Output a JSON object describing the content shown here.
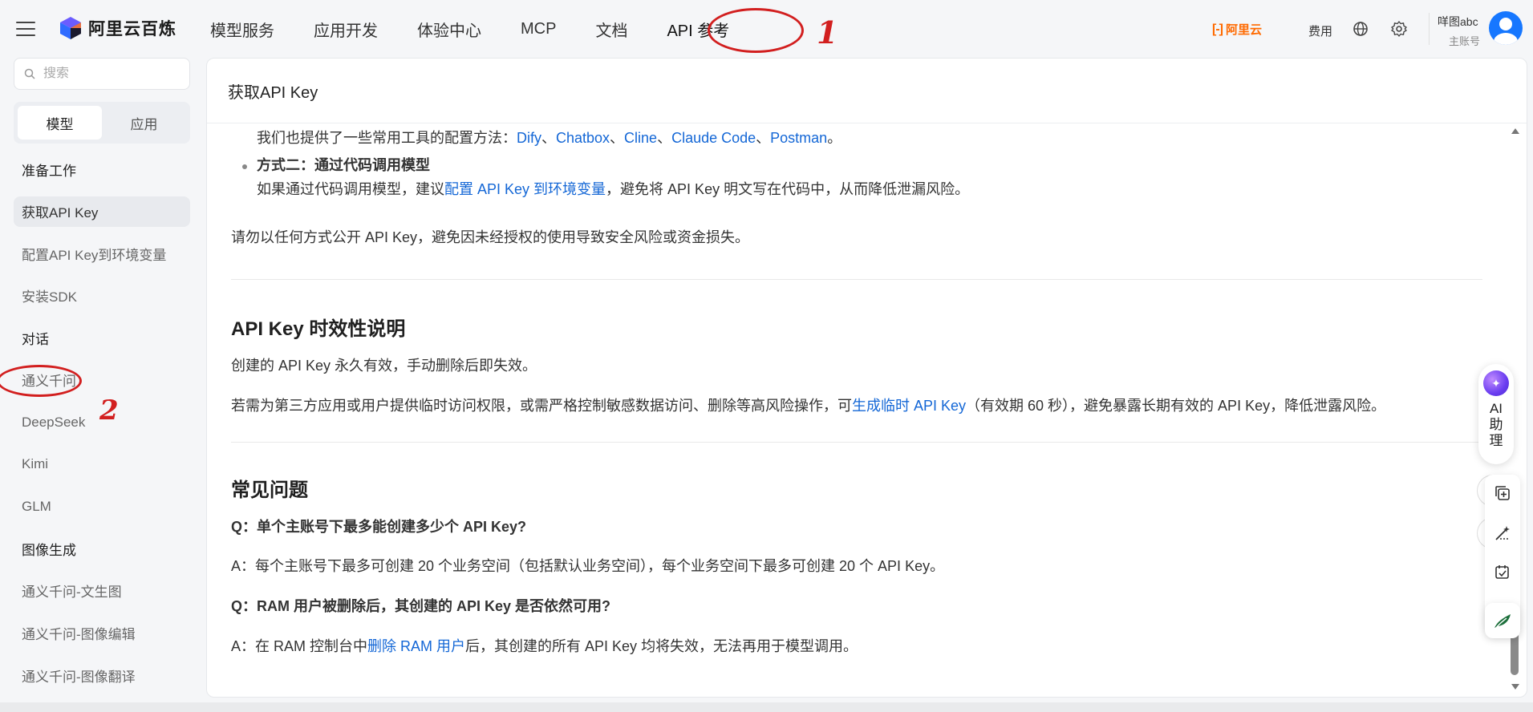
{
  "brand": {
    "name": "阿里云百炼"
  },
  "topnav": {
    "items": [
      {
        "label": "模型服务"
      },
      {
        "label": "应用开发"
      },
      {
        "label": "体验中心"
      },
      {
        "label": "MCP"
      },
      {
        "label": "文档"
      },
      {
        "label": "API 参考",
        "active": true
      }
    ]
  },
  "topright": {
    "aliyun_label": "阿里云",
    "fee_label": "费用",
    "user_name": "咩图abc",
    "user_role": "主账号"
  },
  "annotations": {
    "nav_mark": "1",
    "sidebar_mark": "2"
  },
  "sidebar": {
    "search_placeholder": "搜索",
    "segments": [
      "模型",
      "应用"
    ],
    "items": [
      {
        "label": "准备工作",
        "type": "group"
      },
      {
        "label": "获取API Key",
        "type": "item",
        "active": true
      },
      {
        "label": "配置API Key到环境变量",
        "type": "item"
      },
      {
        "label": "安装SDK",
        "type": "item"
      },
      {
        "label": "对话",
        "type": "group"
      },
      {
        "label": "通义千问",
        "type": "item"
      },
      {
        "label": "DeepSeek",
        "type": "item"
      },
      {
        "label": "Kimi",
        "type": "item"
      },
      {
        "label": "GLM",
        "type": "item"
      },
      {
        "label": "图像生成",
        "type": "group"
      },
      {
        "label": "通义千问-文生图",
        "type": "item"
      },
      {
        "label": "通义千问-图像编辑",
        "type": "item"
      },
      {
        "label": "通义千问-图像翻译",
        "type": "item"
      }
    ]
  },
  "page": {
    "title": "获取API Key",
    "tools_intro": "我们也提供了一些常用工具的配置方法：",
    "tools_links": [
      "Dify",
      "Chatbox",
      "Cline",
      "Claude Code",
      "Postman"
    ],
    "tools_sep": "、",
    "tools_end": "。",
    "method2_title": "方式二：通过代码调用模型",
    "method2_text_a": "如果通过代码调用模型，建议",
    "method2_link": "配置 API Key 到环境变量",
    "method2_text_b": "，避免将 API Key 明文写在代码中，从而降低泄漏风险。",
    "warning": "请勿以任何方式公开 API Key，避免因未经授权的使用导致安全风险或资金损失。",
    "validity_heading": "API Key 时效性说明",
    "validity_p1": "创建的 API Key 永久有效，手动删除后即失效。",
    "validity_p2_a": "若需为第三方应用或用户提供临时访问权限，或需严格控制敏感数据访问、删除等高风险操作，可",
    "validity_p2_link": "生成临时 API Key",
    "validity_p2_b": "（有效期 60 秒），避免暴露长期有效的 API Key，降低泄露风险。",
    "faq_heading": "常见问题",
    "faq_q1": "Q：单个主账号下最多能创建多少个 API Key?",
    "faq_a1": "A：每个主账号下最多可创建 20 个业务空间（包括默认业务空间），每个业务空间下最多可创建 20 个 API Key。",
    "faq_q2": "Q：RAM 用户被删除后，其创建的 API Key 是否依然可用?",
    "faq_a2_a": "A：在 RAM 控制台中",
    "faq_a2_link": "删除 RAM 用户",
    "faq_a2_b": "后，其创建的所有 API Key 均将失效，无法再用于模型调用。"
  },
  "assistant": {
    "label": "AI助理"
  },
  "colors": {
    "link": "#1467d6",
    "accent_orange": "#ff6a00",
    "annotation_red": "#d21f1f"
  }
}
